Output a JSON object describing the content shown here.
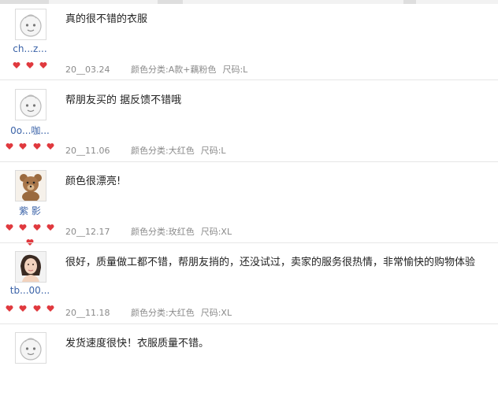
{
  "reviews": [
    {
      "username": "ch...z...",
      "hearts": 3,
      "content": "真的很不错的衣服",
      "date": "20__03.24",
      "color": "颜色分类:A款+藕粉色",
      "size": "尺码:L",
      "avatar": "cartoon-face-icon"
    },
    {
      "username": "0o...咖...",
      "hearts": 4,
      "content": "帮朋友买的  据反馈不错哦",
      "date": "20__11.06",
      "color": "颜色分类:大红色",
      "size": "尺码:L",
      "avatar": "cartoon-face-icon"
    },
    {
      "username": "紫   影",
      "hearts": 5,
      "content": "颜色很漂亮!",
      "date": "20__12.17",
      "color": "颜色分类:玫红色",
      "size": "尺码:XL",
      "avatar": "teddy-bear-icon"
    },
    {
      "username": "tb...00...",
      "hearts": 4,
      "content": "很好，质量做工都不错，帮朋友捎的，还没试过，卖家的服务很热情，非常愉快的购物体验",
      "date": "20__11.18",
      "color": "颜色分类:大红色",
      "size": "尺码:XL",
      "avatar": "woman-photo-icon"
    },
    {
      "username": "",
      "hearts": 0,
      "content": "发货速度很快！衣服质量不错。",
      "date": "",
      "color": "",
      "size": "",
      "avatar": "cartoon-face-icon"
    }
  ],
  "colors": {
    "username": "#3b63a8",
    "heart": "#e0393e",
    "meta": "#8a8a8a",
    "divider": "#e6e6e6"
  }
}
